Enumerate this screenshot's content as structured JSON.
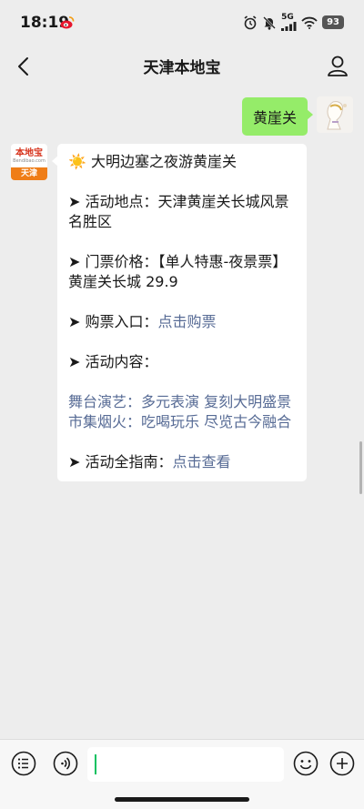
{
  "status_bar": {
    "time": "18:19",
    "battery": "93",
    "network": "5G"
  },
  "nav": {
    "title": "天津本地宝"
  },
  "outgoing": {
    "text": "黄崖关"
  },
  "bot_avatar": {
    "brand": "本地宝",
    "site": "Bendibao.com",
    "city": "天津"
  },
  "incoming": {
    "title_emoji": "☀️",
    "title": "大明边塞之夜游黄崖关",
    "location_label": "➤ 活动地点：天津黄崖关长城风景名胜区",
    "price_label": "➤ 门票价格：【单人特惠-夜景票】黄崖关长城 29.9",
    "buy_label": "➤ 购票入口：",
    "buy_link": "点击购票",
    "content_label": "➤ 活动内容：",
    "stage_line": "舞台演艺：多元表演 复刻大明盛景",
    "market_line": "市集烟火：吃喝玩乐 尽览古今融合",
    "guide_label": "➤ 活动全指南：",
    "guide_link": "点击查看"
  },
  "colors": {
    "accent_green": "#07c160",
    "bubble_green": "#95ec69",
    "link_blue": "#576b95"
  }
}
